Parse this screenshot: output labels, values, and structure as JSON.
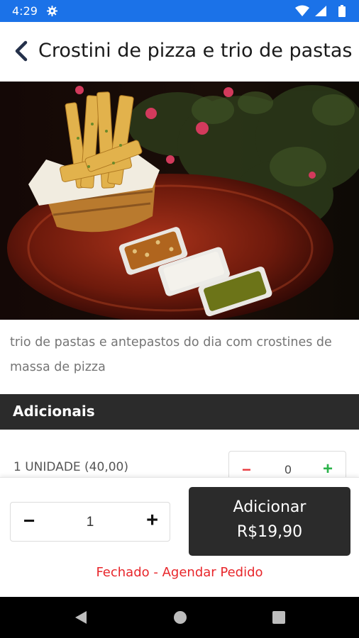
{
  "status_bar": {
    "time": "4:29"
  },
  "header": {
    "title": "Crostini de pizza e trio de pastas"
  },
  "product": {
    "image_alt": "crostini-with-three-dips-photo",
    "description": "trio de pastas e antepastos do dia com crostines de massa de pizza"
  },
  "additionals": {
    "section_title": "Adicionais",
    "items": [
      {
        "label": "1 UNIDADE (40,00)",
        "quantity": "0"
      }
    ]
  },
  "footer": {
    "quantity": "1",
    "add_button_line1": "Adicionar",
    "add_button_line2": "R$19,90",
    "status_text": "Fechado - Agendar Pedido"
  },
  "colors": {
    "status_bar": "#1b72e8",
    "dark": "#2b2b2b",
    "minus_red": "#e8383d",
    "plus_green": "#2bb34a",
    "closed_red": "#e8262b"
  },
  "icons": [
    "gear-icon",
    "wifi-icon",
    "signal-icon",
    "battery-icon",
    "back-arrow-icon",
    "nav-back-icon",
    "nav-home-icon",
    "nav-recents-icon"
  ]
}
